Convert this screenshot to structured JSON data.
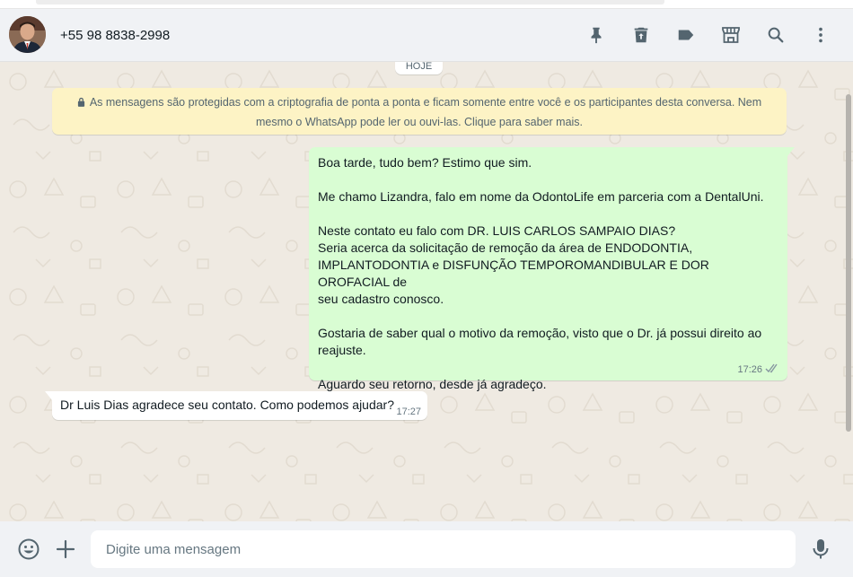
{
  "header": {
    "contact_name": "+55 98 8838-2998",
    "icons": [
      "pin-icon",
      "trash-icon",
      "label-icon",
      "store-icon",
      "search-icon",
      "more-vertical-icon"
    ]
  },
  "chat": {
    "date_chip": "HOJE",
    "encryption_notice": "As mensagens são protegidas com a criptografia de ponta a ponta e ficam somente entre você e os participantes desta conversa. Nem mesmo o WhatsApp pode ler ou ouvi-las. Clique para saber mais.",
    "messages": [
      {
        "direction": "outgoing",
        "text": "Boa tarde, tudo bem? Estimo que sim.\n\nMe chamo Lizandra, falo em nome da OdontoLife em parceria com a DentalUni.\n\nNeste contato eu falo com DR. LUIS CARLOS SAMPAIO DIAS?\nSeria acerca da solicitação de remoção da área de ENDODONTIA,\nIMPLANTODONTIA e DISFUNÇÃO TEMPOROMANDIBULAR E DOR OROFACIAL de\nseu cadastro conosco.\n\nGostaria de saber qual o motivo da remoção, visto que o Dr. já possui direito ao\nreajuste.\n\nAguardo seu retorno, desde já agradeço.",
        "time": "17:26",
        "status": "read-ticks-icon"
      },
      {
        "direction": "incoming",
        "text": "Dr Luis Dias agradece seu contato. Como podemos ajudar?",
        "time": "17:27"
      }
    ]
  },
  "footer": {
    "input_placeholder": "Digite uma mensagem",
    "input_value": ""
  },
  "colors": {
    "header_bg": "#f0f2f5",
    "chat_bg": "#efeae2",
    "outgoing_bubble": "#d9fdd3",
    "incoming_bubble": "#ffffff",
    "encryption_bg": "#fdf3c5",
    "icon": "#54656f"
  }
}
